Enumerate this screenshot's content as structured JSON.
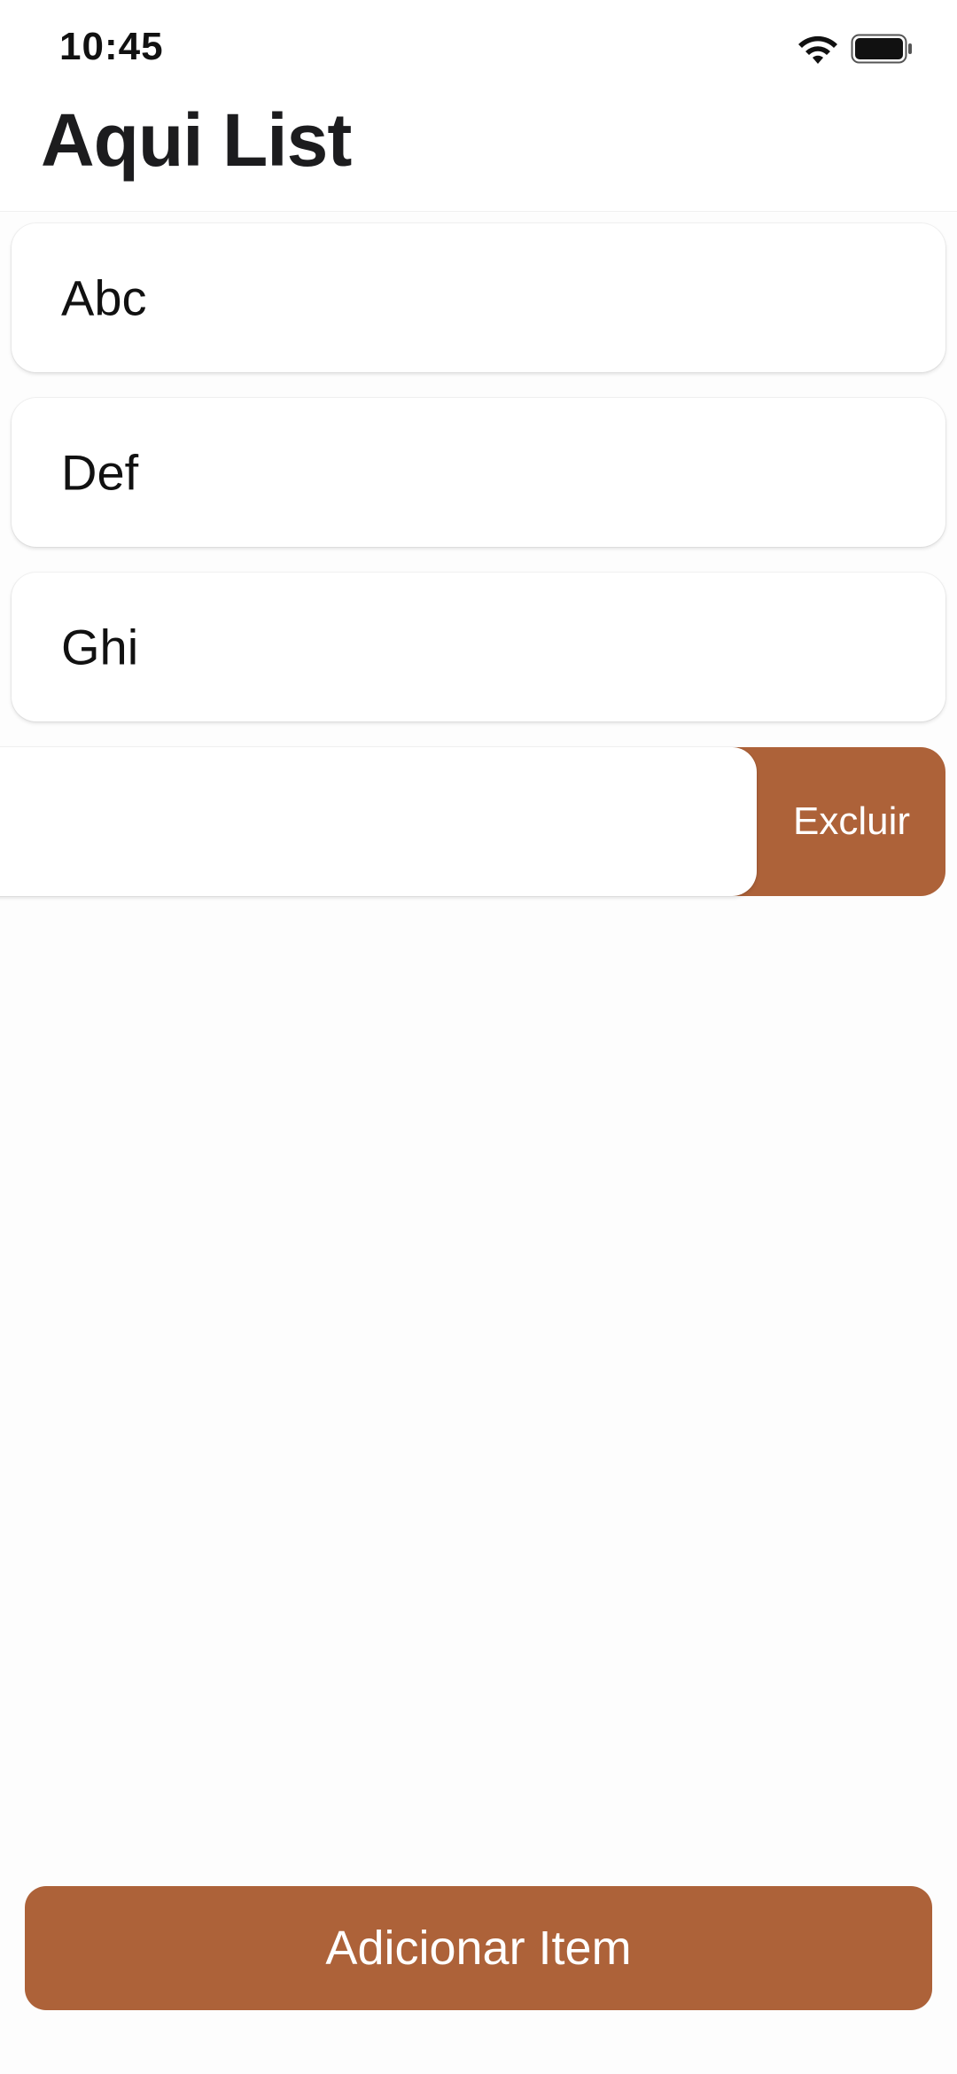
{
  "status_bar": {
    "time": "10:45",
    "icons": [
      "wifi-icon",
      "battery-icon"
    ]
  },
  "header": {
    "title": "Aqui List"
  },
  "list": {
    "items": [
      {
        "label": "Abc"
      },
      {
        "label": "Def"
      },
      {
        "label": "Ghi"
      }
    ],
    "swiped_item": {
      "label": "",
      "action_label": "Excluir"
    }
  },
  "footer": {
    "add_button_label": "Adicionar Item"
  },
  "colors": {
    "accent": "#ad6239",
    "background": "#fdfdfd",
    "card": "#ffffff",
    "text": "#111111"
  }
}
